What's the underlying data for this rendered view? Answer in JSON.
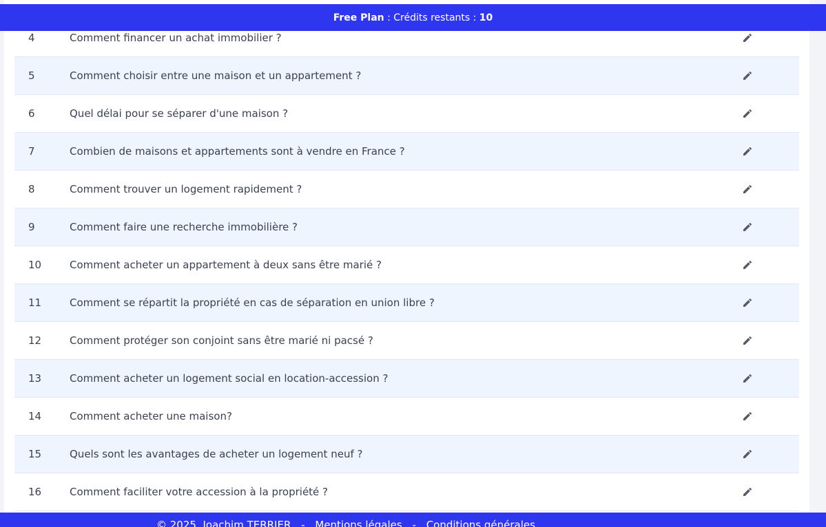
{
  "banner": {
    "plan": "Free Plan",
    "separator": " : ",
    "credits_label": "Crédits restants : ",
    "credits_value": "10"
  },
  "questions": [
    {
      "num": "4",
      "text": "Comment financer un achat immobilier ?"
    },
    {
      "num": "5",
      "text": "Comment choisir entre une maison et un appartement ?"
    },
    {
      "num": "6",
      "text": "Quel délai pour se séparer d'une maison ?"
    },
    {
      "num": "7",
      "text": "Combien de maisons et appartements sont à vendre en France ?"
    },
    {
      "num": "8",
      "text": "Comment trouver un logement rapidement ?"
    },
    {
      "num": "9",
      "text": "Comment faire une recherche immobilière ?"
    },
    {
      "num": "10",
      "text": "Comment acheter un appartement à deux sans être marié ?"
    },
    {
      "num": "11",
      "text": "Comment se répartit la propriété en cas de séparation en union libre ?"
    },
    {
      "num": "12",
      "text": "Comment protéger son conjoint sans être marié ni pacsé ?"
    },
    {
      "num": "13",
      "text": "Comment acheter un logement social en location-accession ?"
    },
    {
      "num": "14",
      "text": "Comment acheter une maison?"
    },
    {
      "num": "15",
      "text": "Quels sont les avantages de acheter un logement neuf ?"
    },
    {
      "num": "16",
      "text": "Comment faciliter votre accession à la propriété ?"
    }
  ],
  "edit_icon": "pencil-icon",
  "footer": {
    "copyright": "© 2025, Joachim TERRIER",
    "separator": "-",
    "legal": "Mentions légales",
    "terms": "Conditions générales"
  },
  "colors": {
    "brand": "#2f36f0",
    "row_alt": "#eef5fe"
  }
}
